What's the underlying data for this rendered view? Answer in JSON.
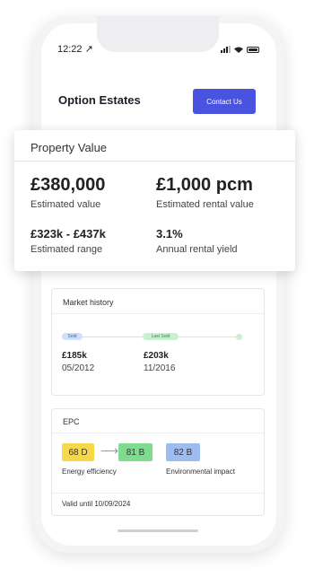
{
  "status_bar": {
    "time": "12:22 ↗"
  },
  "header": {
    "brand": "Option Estates",
    "contact_button": "Contact Us"
  },
  "property_value": {
    "title": "Property Value",
    "estimated_value": "£380,000",
    "estimated_value_label": "Estimated value",
    "rental_value": "£1,000 pcm",
    "rental_value_label": "Estimated rental value",
    "range": "£323k - £437k",
    "range_label": "Estimated range",
    "yield": "3.1%",
    "yield_label": "Annual rental yield"
  },
  "market_history": {
    "title": "Market history",
    "entries": [
      {
        "tag": "Sold",
        "price": "£185k",
        "date": "05/2012"
      },
      {
        "tag": "Last Sold",
        "price": "£203k",
        "date": "11/2016"
      }
    ]
  },
  "epc": {
    "title": "EPC",
    "current": "68 D",
    "potential": "81 B",
    "environmental": "82 B",
    "energy_label": "Energy efficiency",
    "environmental_label": "Environmental impact",
    "valid": "Valid until 10/09/2024"
  },
  "colors": {
    "accent": "#4a52e0",
    "epc_d": "#f5d94a",
    "epc_b_green": "#7fdc8e",
    "epc_b_blue": "#9cbcf2"
  }
}
